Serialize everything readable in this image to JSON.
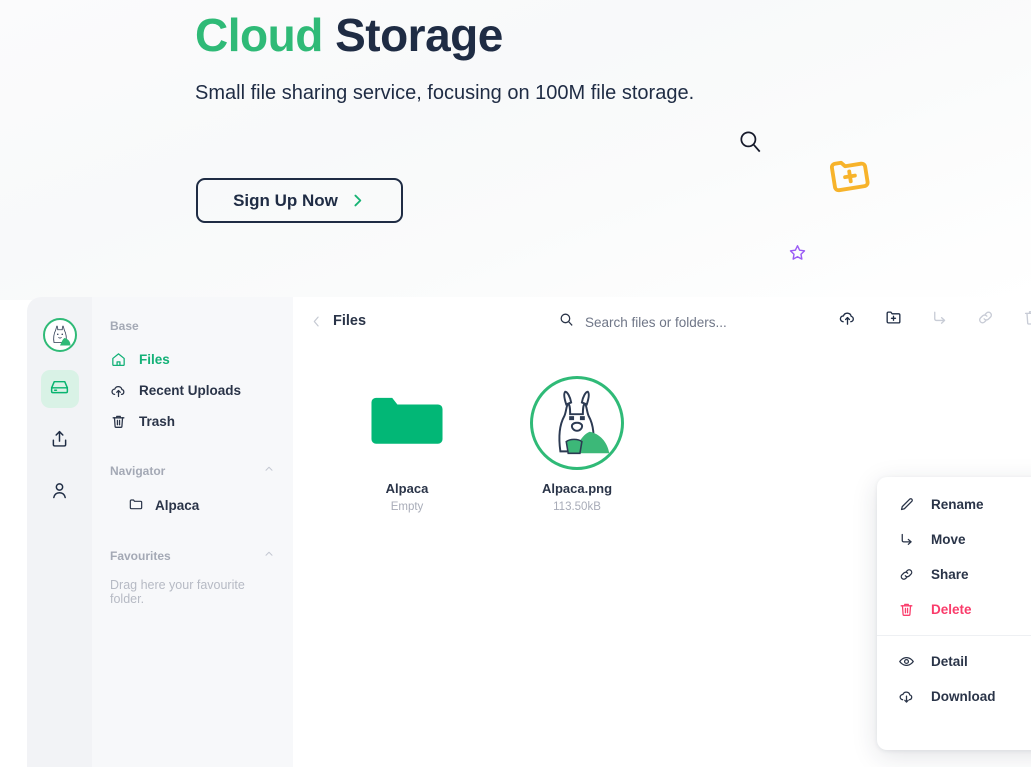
{
  "hero": {
    "title_part1": "Cloud",
    "title_part2": "Storage",
    "subtitle": "Small file sharing service, focusing on 100M file storage.",
    "signup_label": "Sign Up Now",
    "search_icon": "search-icon",
    "chevron_icon": "chevron-right-icon",
    "decor_folder_icon": "folder-plus-icon",
    "decor_star_icon": "star-icon",
    "accent_green": "#2fba77",
    "dark_navy": "#1f2c44",
    "decor_folder_color": "#f7b32b",
    "decor_star_color": "#9a5cf5"
  },
  "rail": {
    "logo_icon": "alpaca-logo",
    "items": [
      {
        "icon": "drive-icon",
        "name": "drive",
        "active": true
      },
      {
        "icon": "upload-icon",
        "name": "upload",
        "active": false
      },
      {
        "icon": "user-icon",
        "name": "account",
        "active": false
      }
    ]
  },
  "sidebar": {
    "base_heading": "Base",
    "base_items": [
      {
        "label": "Files",
        "icon": "home-icon",
        "active": true
      },
      {
        "label": "Recent Uploads",
        "icon": "cloud-upload-icon",
        "active": false
      },
      {
        "label": "Trash",
        "icon": "trash-icon",
        "active": false
      }
    ],
    "navigator_heading": "Navigator",
    "navigator_collapse_icon": "chevron-up-icon",
    "navigator_items": [
      {
        "label": "Alpaca",
        "icon": "folder-icon"
      }
    ],
    "favourites_heading": "Favourites",
    "favourites_collapse_icon": "chevron-up-icon",
    "favourites_empty": "Drag here your favourite folder."
  },
  "toolbar": {
    "back_icon": "chevron-left-icon",
    "breadcrumb": "Files",
    "search_icon": "search-icon",
    "search_placeholder": "Search files or folders...",
    "actions": [
      {
        "name": "upload-cloud-button",
        "icon": "cloud-upload-icon",
        "disabled": false
      },
      {
        "name": "new-folder-button",
        "icon": "folder-plus-icon",
        "disabled": false
      },
      {
        "name": "move-button",
        "icon": "move-arrow-icon",
        "disabled": true
      },
      {
        "name": "share-link-button",
        "icon": "link-icon",
        "disabled": true
      },
      {
        "name": "delete-button",
        "icon": "trash-icon",
        "disabled": true
      }
    ]
  },
  "files": [
    {
      "name": "Alpaca",
      "meta": "Empty",
      "kind": "folder"
    },
    {
      "name": "Alpaca.png",
      "meta": "113.50kB",
      "kind": "image"
    }
  ],
  "context_menu": {
    "items": [
      {
        "label": "Rename",
        "icon": "pencil-icon",
        "danger": false
      },
      {
        "label": "Move",
        "icon": "move-arrow-icon",
        "danger": false
      },
      {
        "label": "Share",
        "icon": "link-icon",
        "danger": false
      },
      {
        "label": "Delete",
        "icon": "trash-icon",
        "danger": true
      },
      {
        "label": "Detail",
        "icon": "eye-icon",
        "danger": false
      },
      {
        "label": "Download",
        "icon": "cloud-download-icon",
        "danger": false
      }
    ],
    "danger_color": "#fa3c6b"
  }
}
